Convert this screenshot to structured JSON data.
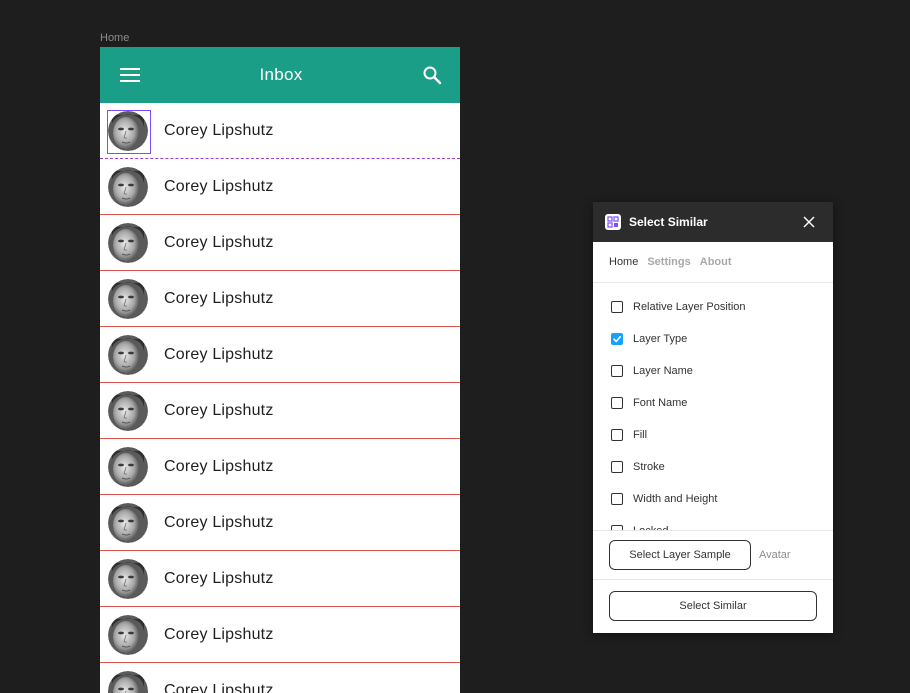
{
  "canvas": {
    "frame_label": "Home"
  },
  "app": {
    "title": "Inbox",
    "accent": "#1a9e87",
    "divider_color": "#d9534f",
    "items": [
      {
        "name": "Corey Lipshutz",
        "selected": true
      },
      {
        "name": "Corey Lipshutz"
      },
      {
        "name": "Corey Lipshutz"
      },
      {
        "name": "Corey Lipshutz"
      },
      {
        "name": "Corey Lipshutz"
      },
      {
        "name": "Corey Lipshutz"
      },
      {
        "name": "Corey Lipshutz"
      },
      {
        "name": "Corey Lipshutz"
      },
      {
        "name": "Corey Lipshutz"
      },
      {
        "name": "Corey Lipshutz"
      },
      {
        "name": "Corey Lipshutz"
      }
    ]
  },
  "plugin": {
    "title": "Select Similar",
    "tabs": [
      {
        "label": "Home",
        "active": true
      },
      {
        "label": "Settings"
      },
      {
        "label": "About"
      }
    ],
    "options": [
      {
        "label": "Relative Layer Position",
        "checked": false
      },
      {
        "label": "Layer Type",
        "checked": true
      },
      {
        "label": "Layer Name",
        "checked": false
      },
      {
        "label": "Font Name",
        "checked": false
      },
      {
        "label": "Fill",
        "checked": false
      },
      {
        "label": "Stroke",
        "checked": false
      },
      {
        "label": "Width and Height",
        "checked": false
      },
      {
        "label": "Locked",
        "checked": false
      }
    ],
    "sample_button_label": "Select Layer Sample",
    "sample_value": "Avatar",
    "action_button_label": "Select Similar",
    "check_color": "#18a0fb"
  }
}
